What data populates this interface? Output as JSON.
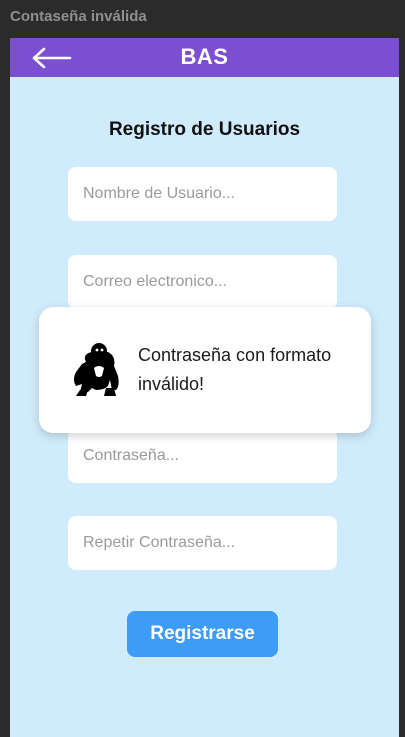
{
  "window": {
    "title": "Contaseña inválida"
  },
  "appbar": {
    "title": "BAS",
    "back_icon": "arrow-left-icon",
    "color": "#7b4fd0"
  },
  "form": {
    "title": "Registro de Usuarios",
    "username_placeholder": "Nombre de Usuario...",
    "email_placeholder": "Correo electronico...",
    "password_placeholder": "Contraseña...",
    "repeat_password_placeholder": "Repetir Contraseña...",
    "submit_label": "Registrarse",
    "submit_color": "#3d9cf6",
    "background": "#d0ecfc"
  },
  "toast": {
    "icon": "gorilla-icon",
    "message": "Contraseña con formato inválido!"
  }
}
